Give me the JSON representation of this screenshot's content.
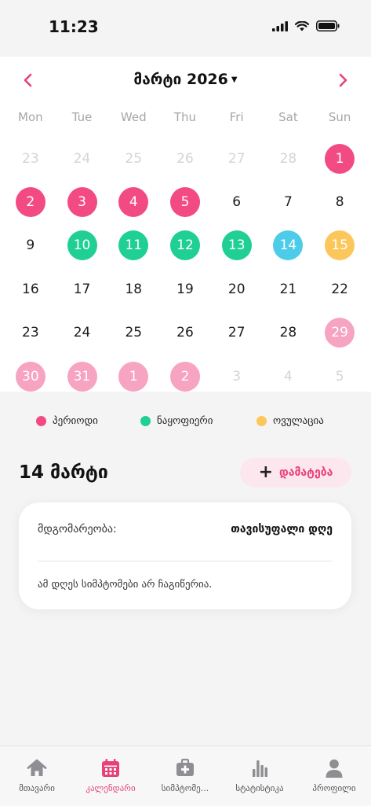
{
  "status": {
    "time": "11:23"
  },
  "calendar": {
    "month_title": "მარტი 2026",
    "weekdays": [
      "Mon",
      "Tue",
      "Wed",
      "Thu",
      "Fri",
      "Sat",
      "Sun"
    ],
    "days": [
      {
        "label": "23",
        "type": "muted"
      },
      {
        "label": "24",
        "type": "muted"
      },
      {
        "label": "25",
        "type": "muted"
      },
      {
        "label": "26",
        "type": "muted"
      },
      {
        "label": "27",
        "type": "muted"
      },
      {
        "label": "28",
        "type": "muted"
      },
      {
        "label": "1",
        "type": "period"
      },
      {
        "label": "2",
        "type": "period"
      },
      {
        "label": "3",
        "type": "period"
      },
      {
        "label": "4",
        "type": "period"
      },
      {
        "label": "5",
        "type": "period"
      },
      {
        "label": "6",
        "type": "normal"
      },
      {
        "label": "7",
        "type": "normal"
      },
      {
        "label": "8",
        "type": "normal"
      },
      {
        "label": "9",
        "type": "normal"
      },
      {
        "label": "10",
        "type": "fertile"
      },
      {
        "label": "11",
        "type": "fertile"
      },
      {
        "label": "12",
        "type": "fertile"
      },
      {
        "label": "13",
        "type": "fertile"
      },
      {
        "label": "14",
        "type": "ovulation-day"
      },
      {
        "label": "15",
        "type": "ovulation"
      },
      {
        "label": "16",
        "type": "normal"
      },
      {
        "label": "17",
        "type": "normal"
      },
      {
        "label": "18",
        "type": "normal"
      },
      {
        "label": "19",
        "type": "normal"
      },
      {
        "label": "20",
        "type": "normal"
      },
      {
        "label": "21",
        "type": "normal"
      },
      {
        "label": "22",
        "type": "normal"
      },
      {
        "label": "23",
        "type": "normal"
      },
      {
        "label": "24",
        "type": "normal"
      },
      {
        "label": "25",
        "type": "normal"
      },
      {
        "label": "26",
        "type": "normal"
      },
      {
        "label": "27",
        "type": "normal"
      },
      {
        "label": "28",
        "type": "normal"
      },
      {
        "label": "29",
        "type": "period-light"
      },
      {
        "label": "30",
        "type": "period-light"
      },
      {
        "label": "31",
        "type": "period-light"
      },
      {
        "label": "1",
        "type": "period-light"
      },
      {
        "label": "2",
        "type": "period-light"
      },
      {
        "label": "3",
        "type": "muted"
      },
      {
        "label": "4",
        "type": "muted"
      },
      {
        "label": "5",
        "type": "muted"
      }
    ]
  },
  "legend": [
    {
      "label": "პერიოდი",
      "color": "#f24b84"
    },
    {
      "label": "ნაყოფიერი",
      "color": "#1fcf94"
    },
    {
      "label": "ოვულაცია",
      "color": "#fcc75a"
    }
  ],
  "selected": {
    "date_title": "14 მარტი",
    "add_label": "დამატება",
    "status_label": "მდგომარეობა:",
    "status_value": "თავისუფალი დღე",
    "note": "ამ დღეს სიმპტომები არ ჩაგიწერია."
  },
  "tabs": [
    {
      "label": "მთავარი",
      "icon": "home-icon",
      "active": false
    },
    {
      "label": "კალენდარი",
      "icon": "calendar-icon",
      "active": true
    },
    {
      "label": "სიმპტომე...",
      "icon": "medkit-icon",
      "active": false
    },
    {
      "label": "სტატისტიკა",
      "icon": "chart-icon",
      "active": false
    },
    {
      "label": "პროფილი",
      "icon": "profile-icon",
      "active": false
    }
  ],
  "colors": {
    "accent": "#e8417a",
    "period": "#f24b84",
    "fertile": "#1fcf94",
    "ovulation": "#fcc75a",
    "ovulation_day": "#4ccce8"
  }
}
